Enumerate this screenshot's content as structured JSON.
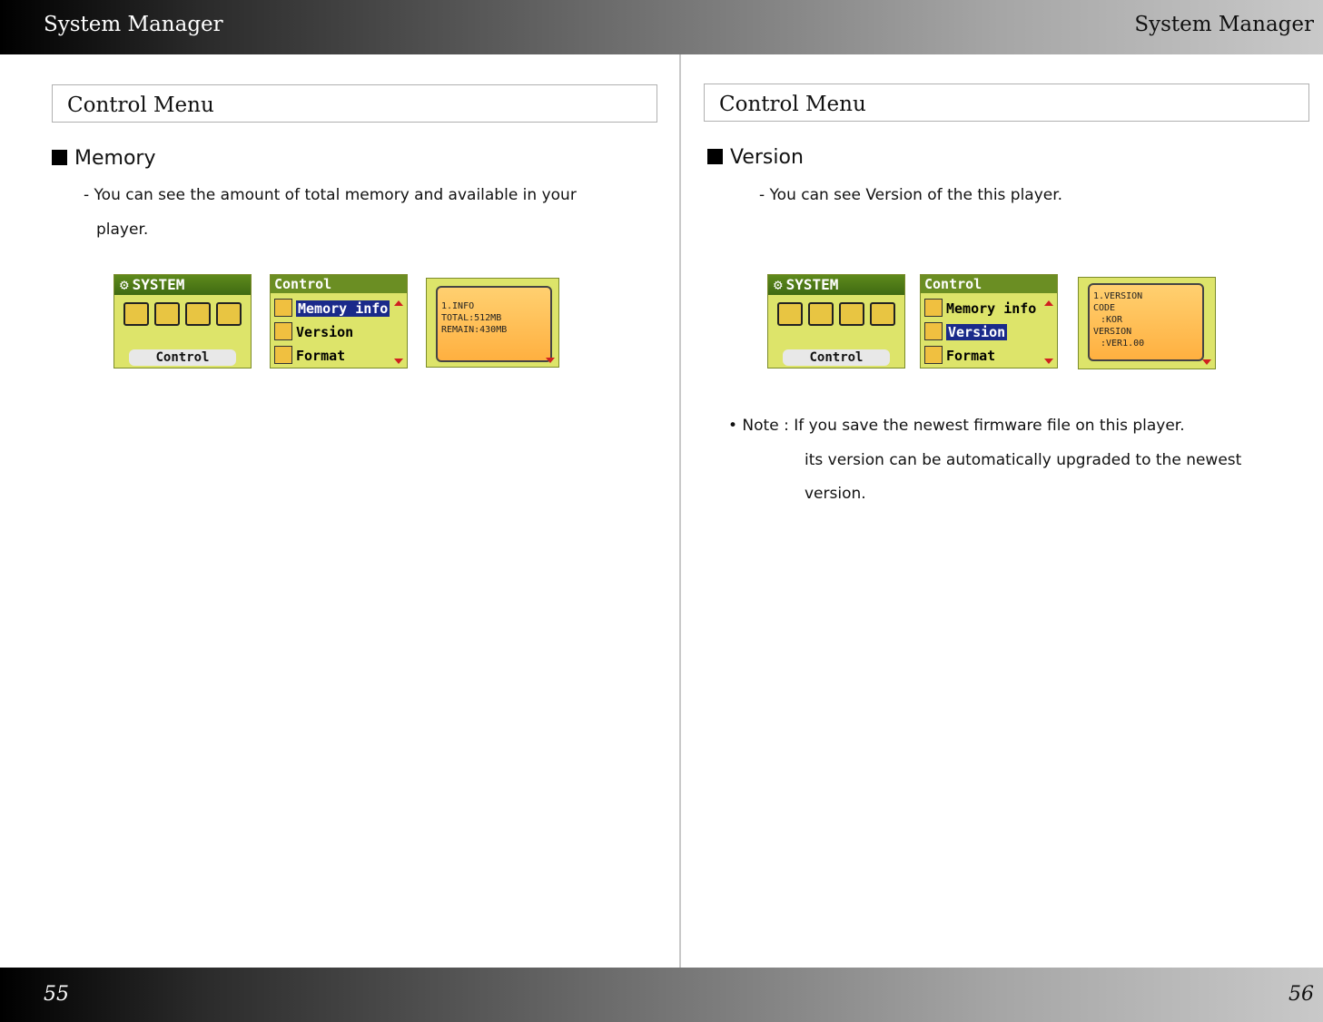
{
  "header": {
    "left_title": "System Manager",
    "right_title": "System Manager"
  },
  "footer": {
    "left_page": "55",
    "right_page": "56"
  },
  "left": {
    "section_title": "Control Menu",
    "heading": "Memory",
    "desc_line1": "- You can see the amount of total memory and available in your",
    "desc_line2": "player.",
    "screens": {
      "system_title": "SYSTEM",
      "system_label": "Control",
      "menu_title": "Control",
      "menu_items": [
        "Memory info",
        "Version",
        "Format"
      ],
      "popup_lines": [
        "1.INFO",
        "TOTAL:512MB",
        "REMAIN:430MB"
      ]
    }
  },
  "right": {
    "section_title": "Control Menu",
    "heading": "Version",
    "desc_line1": "- You can see Version of the this player.",
    "screens": {
      "system_title": "SYSTEM",
      "system_label": "Control",
      "menu_title": "Control",
      "menu_items": [
        "Memory info",
        "Version",
        "Format"
      ],
      "popup_lines": [
        "1.VERSION",
        "CODE",
        ":KOR",
        "VERSION",
        ":VER1.00"
      ]
    },
    "note_line1": "• Note : If you save the newest firmware file on this player.",
    "note_line2": "its version can be automatically upgraded to the newest",
    "note_line3": "version."
  }
}
